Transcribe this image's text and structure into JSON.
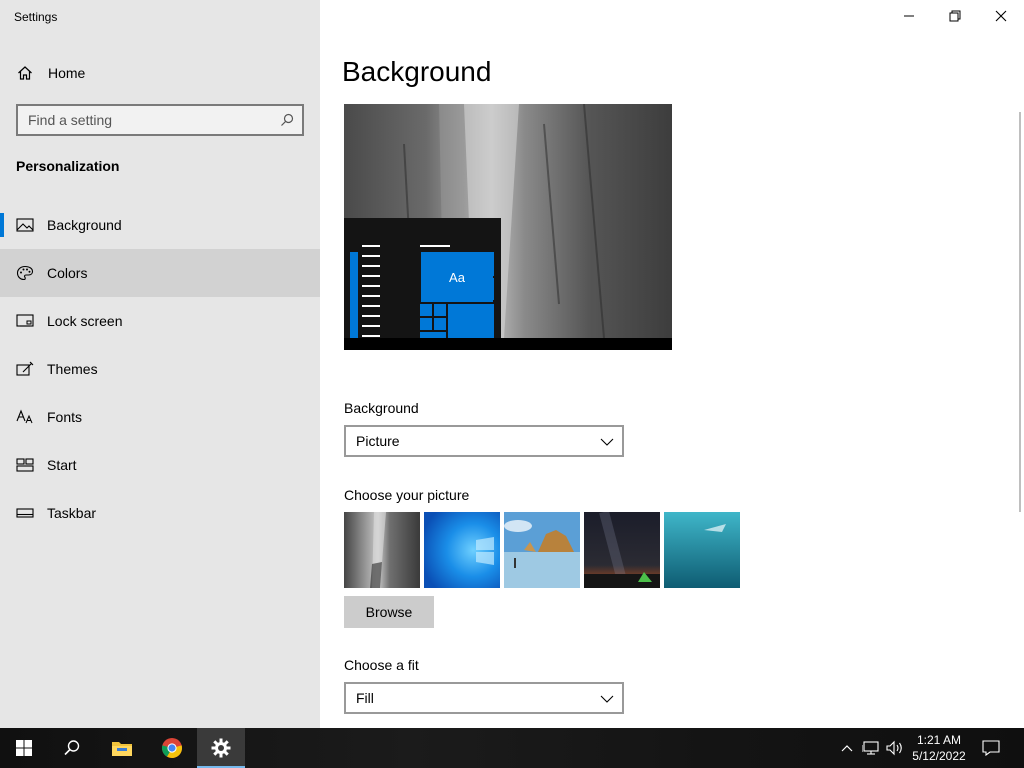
{
  "window": {
    "title": "Settings",
    "minimize_glyph": "—",
    "maximize_glyph": "❐",
    "close_glyph": "✕"
  },
  "sidebar": {
    "home_label": "Home",
    "search_placeholder": "Find a setting",
    "section_title": "Personalization",
    "items": [
      {
        "label": "Background",
        "icon": "picture-icon",
        "selected": true
      },
      {
        "label": "Colors",
        "icon": "palette-icon",
        "hover": true
      },
      {
        "label": "Lock screen",
        "icon": "lock-screen-icon"
      },
      {
        "label": "Themes",
        "icon": "themes-icon"
      },
      {
        "label": "Fonts",
        "icon": "fonts-icon"
      },
      {
        "label": "Start",
        "icon": "start-icon"
      },
      {
        "label": "Taskbar",
        "icon": "taskbar-icon"
      }
    ]
  },
  "main": {
    "page_title": "Background",
    "preview_tile_text": "Aa",
    "background_label": "Background",
    "background_value": "Picture",
    "choose_picture_label": "Choose your picture",
    "browse_label": "Browse",
    "choose_fit_label": "Choose a fit",
    "fit_value": "Fill"
  },
  "taskbar": {
    "time": "1:21 AM",
    "date": "5/12/2022",
    "apps": [
      "start-icon",
      "search-icon",
      "file-explorer-icon",
      "chrome-icon",
      "settings-gear-icon"
    ]
  },
  "colors": {
    "accent": "#0078d7",
    "sidebar_bg": "#e6e6e6",
    "hover_bg": "#d2d2d2"
  }
}
